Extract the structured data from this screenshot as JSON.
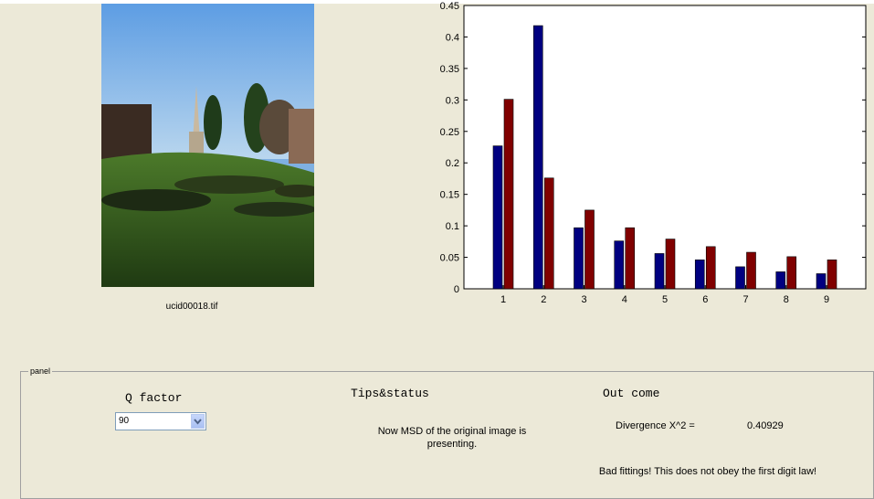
{
  "image": {
    "filename": "ucid00018.tif"
  },
  "chart_data": {
    "type": "bar",
    "categories": [
      "1",
      "2",
      "3",
      "4",
      "5",
      "6",
      "7",
      "8",
      "9"
    ],
    "series": [
      {
        "values": [
          0.227,
          0.418,
          0.097,
          0.076,
          0.056,
          0.046,
          0.035,
          0.027,
          0.024
        ],
        "color": "#000080"
      },
      {
        "values": [
          0.301,
          0.176,
          0.125,
          0.097,
          0.079,
          0.067,
          0.058,
          0.051,
          0.046
        ],
        "color": "#800000"
      }
    ],
    "ylim": [
      0,
      0.45
    ],
    "yticks": [
      "0",
      "0.05",
      "0.1",
      "0.15",
      "0.2",
      "0.25",
      "0.3",
      "0.35",
      "0.4",
      "0.45"
    ],
    "ytick_values": [
      0,
      0.05,
      0.1,
      0.15,
      0.2,
      0.25,
      0.3,
      0.35,
      0.4,
      0.45
    ],
    "grid": false
  },
  "panel": {
    "title": "panel",
    "q_factor_label": "Q factor",
    "q_factor_value": "90",
    "tips_label": "Tips&status",
    "status_text": "Now MSD of the original image is presenting.",
    "outcome_label": "Out come",
    "divergence_label": "Divergence X^2 =",
    "divergence_value": "0.40929",
    "verdict_text": "Bad fittings! This does not obey the first digit law!"
  }
}
